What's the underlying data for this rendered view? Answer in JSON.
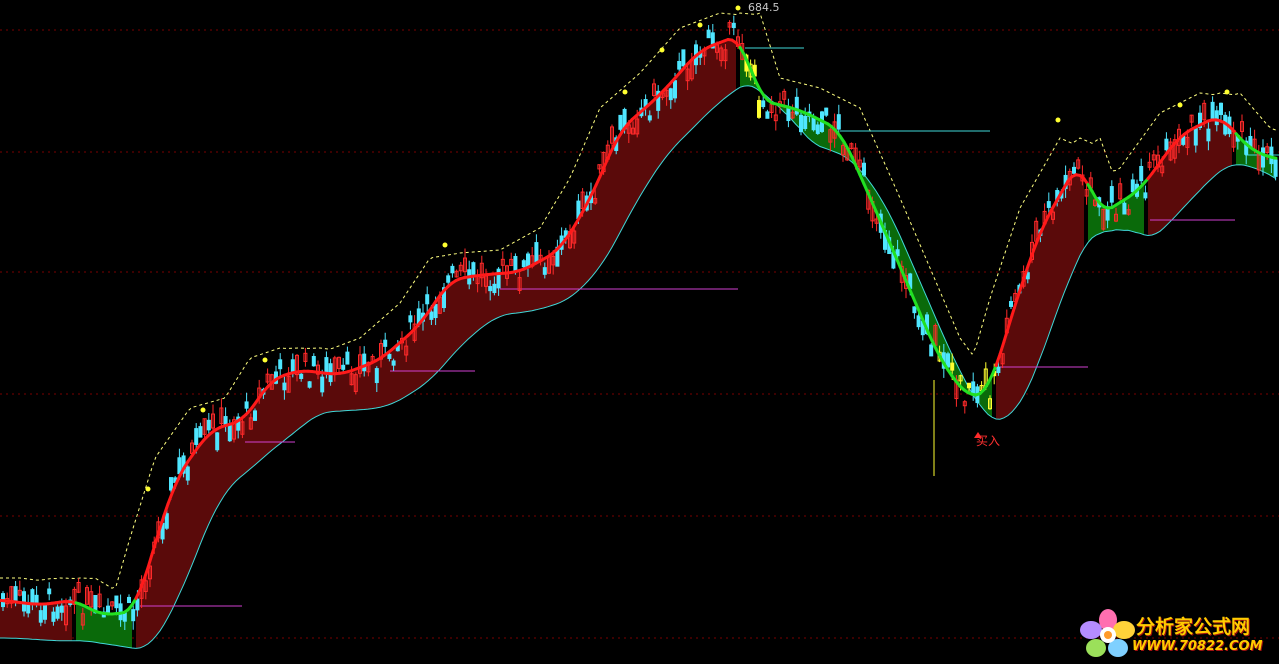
{
  "chart_data": {
    "type": "candlestick",
    "peak_label": "684.5",
    "signal_label": "买入",
    "overlays": [
      "upper band (dashed)",
      "red/green trend line",
      "lower band (cyan)",
      "filled channel"
    ],
    "colors": {
      "background": "#000000",
      "grid": "#7a0000",
      "up_candle": "#ff2a2a",
      "down_candle": "#4fe6ff",
      "trend_up": "#ff1a1a",
      "trend_down": "#22e022",
      "channel_up": "#5a0a0a",
      "channel_down": "#0a6a0a",
      "lower_band": "#40d8d8",
      "upper_band": "#ffff80",
      "signal_line": "#d040d0",
      "signal_marker": "#ffff30"
    }
  },
  "watermark": {
    "line1": "分析家公式网",
    "line2": "WWW.70822.COM"
  }
}
